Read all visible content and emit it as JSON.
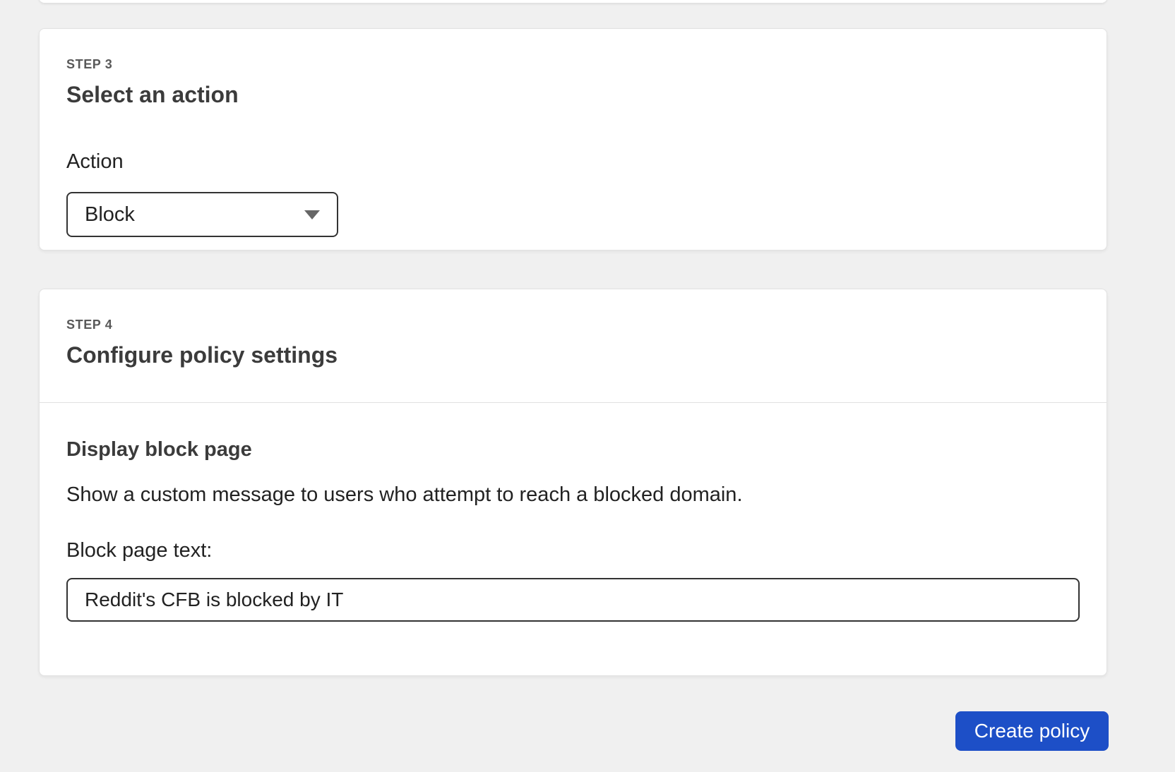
{
  "page": {
    "background_color": "#f0f0f0",
    "accent_color": "#1d4fc7"
  },
  "step3_card": {
    "step_label": "STEP 3",
    "title": "Select an action",
    "action_field": {
      "label": "Action",
      "selected_value": "Block",
      "caret_icon": "chevron-down-icon"
    }
  },
  "step4_card": {
    "step_label": "STEP 4",
    "title": "Configure policy settings",
    "block_page_section": {
      "heading": "Display block page",
      "description": "Show a custom message to users who attempt to reach a blocked domain.",
      "input_label": "Block page text:",
      "input_value": "Reddit's CFB is blocked by IT"
    }
  },
  "footer": {
    "create_policy_label": "Create policy"
  }
}
